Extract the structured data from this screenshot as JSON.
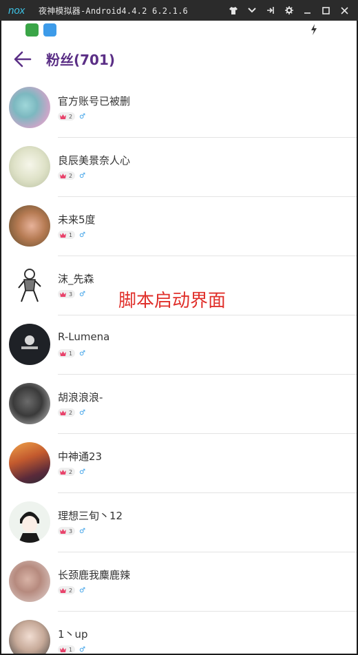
{
  "window": {
    "title": "夜神模拟器-Android4.4.2 6.2.1.6",
    "controls": [
      "shirt-icon",
      "chevron-down-icon",
      "pin-icon",
      "gear-icon",
      "minimize-icon",
      "maximize-icon",
      "close-icon"
    ]
  },
  "appbar": {
    "title": "粉丝(701)"
  },
  "overlay_text": "脚本启动界面",
  "colors": {
    "accent": "#5b2f86",
    "crown": "#e8436b",
    "male": "#3aa0e8",
    "overlay": "#e0302b"
  },
  "followers": [
    {
      "name": "官方账号已被删",
      "level": "2",
      "sex": "♂"
    },
    {
      "name": "良辰美景奈人心",
      "level": "2",
      "sex": "♂"
    },
    {
      "name": "未来5度",
      "level": "1",
      "sex": "♂"
    },
    {
      "name": "沫_先森",
      "level": "3",
      "sex": "♂"
    },
    {
      "name": "R-Lumena",
      "level": "1",
      "sex": "♂"
    },
    {
      "name": "胡浪浪浪-",
      "level": "2",
      "sex": "♂"
    },
    {
      "name": "中神通23",
      "level": "2",
      "sex": "♂"
    },
    {
      "name": "理想三旬丶12",
      "level": "3",
      "sex": "♂"
    },
    {
      "name": "长颈鹿我麋鹿辣",
      "level": "2",
      "sex": "♂"
    },
    {
      "name": "1丶up",
      "level": "1",
      "sex": "♂"
    }
  ]
}
